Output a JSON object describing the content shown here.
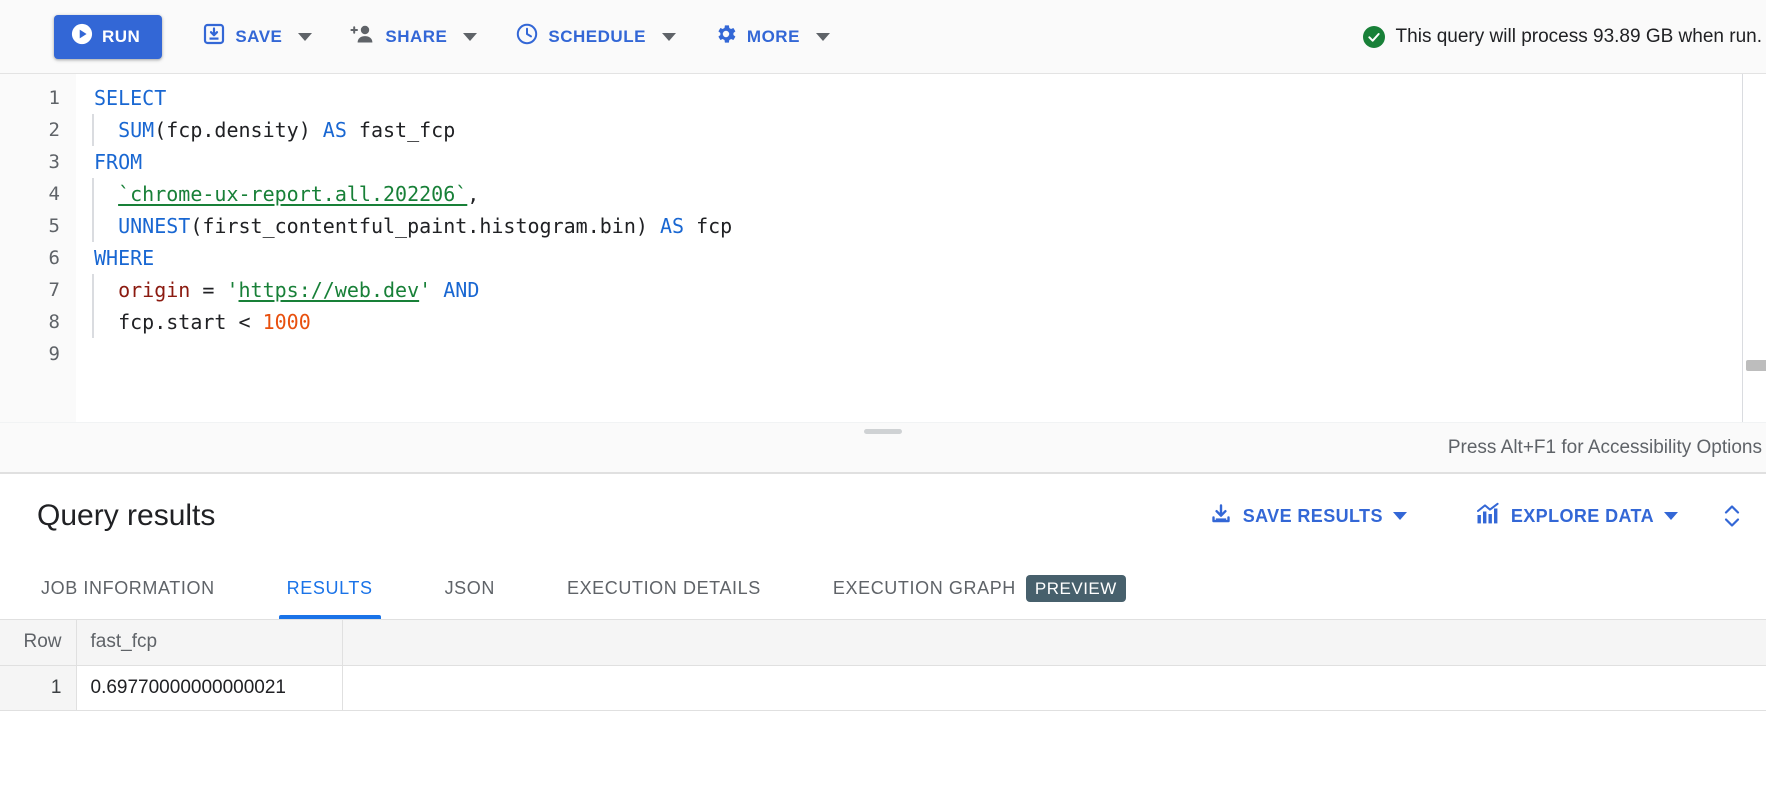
{
  "toolbar": {
    "run_label": "RUN",
    "save_label": "SAVE",
    "share_label": "SHARE",
    "schedule_label": "SCHEDULE",
    "more_label": "MORE",
    "status_text": "This query will process 93.89 GB when run."
  },
  "editor": {
    "line_numbers": [
      "1",
      "2",
      "3",
      "4",
      "5",
      "6",
      "7",
      "8",
      "9"
    ],
    "lines": [
      {
        "n": "1",
        "tokens": [
          {
            "t": "SELECT",
            "c": "kw"
          }
        ]
      },
      {
        "n": "2",
        "tokens": [
          {
            "t": "  ",
            "c": "plain"
          },
          {
            "t": "SUM",
            "c": "fn"
          },
          {
            "t": "(fcp.density) ",
            "c": "plain"
          },
          {
            "t": "AS",
            "c": "kw"
          },
          {
            "t": " fast_fcp",
            "c": "plain"
          }
        ]
      },
      {
        "n": "3",
        "tokens": [
          {
            "t": "FROM",
            "c": "kw"
          }
        ]
      },
      {
        "n": "4",
        "tokens": [
          {
            "t": "  ",
            "c": "plain"
          },
          {
            "t": "`chrome-ux-report.all.202206`",
            "c": "link"
          },
          {
            "t": ",",
            "c": "plain"
          }
        ]
      },
      {
        "n": "5",
        "tokens": [
          {
            "t": "  ",
            "c": "plain"
          },
          {
            "t": "UNNEST",
            "c": "fn"
          },
          {
            "t": "(first_contentful_paint.histogram.bin) ",
            "c": "plain"
          },
          {
            "t": "AS",
            "c": "kw"
          },
          {
            "t": " fcp",
            "c": "plain"
          }
        ]
      },
      {
        "n": "6",
        "tokens": [
          {
            "t": "WHERE",
            "c": "kw"
          }
        ]
      },
      {
        "n": "7",
        "tokens": [
          {
            "t": "  ",
            "c": "plain"
          },
          {
            "t": "origin",
            "c": "field"
          },
          {
            "t": " = ",
            "c": "plain"
          },
          {
            "t": "'",
            "c": "str"
          },
          {
            "t": "https://web.dev",
            "c": "link"
          },
          {
            "t": "'",
            "c": "str"
          },
          {
            "t": " ",
            "c": "plain"
          },
          {
            "t": "AND",
            "c": "kw"
          }
        ]
      },
      {
        "n": "8",
        "tokens": [
          {
            "t": "  ",
            "c": "plain"
          },
          {
            "t": "fcp.start < ",
            "c": "plain"
          },
          {
            "t": "1000",
            "c": "num"
          }
        ]
      },
      {
        "n": "9",
        "tokens": []
      }
    ],
    "accessibility_hint": "Press Alt+F1 for Accessibility Options"
  },
  "results": {
    "title": "Query results",
    "save_results_label": "SAVE RESULTS",
    "explore_data_label": "EXPLORE DATA",
    "tabs": [
      {
        "label": "JOB INFORMATION",
        "active": false,
        "badge": null
      },
      {
        "label": "RESULTS",
        "active": true,
        "badge": null
      },
      {
        "label": "JSON",
        "active": false,
        "badge": null
      },
      {
        "label": "EXECUTION DETAILS",
        "active": false,
        "badge": null
      },
      {
        "label": "EXECUTION GRAPH",
        "active": false,
        "badge": "PREVIEW"
      }
    ],
    "table": {
      "columns": [
        "Row",
        "fast_fcp"
      ],
      "rows": [
        {
          "row": "1",
          "fast_fcp": "0.69770000000000021"
        }
      ]
    }
  },
  "colors": {
    "accent_blue": "#3367d6",
    "tab_blue": "#1a73e8",
    "success_green": "#188038",
    "preview_badge": "#47606c",
    "keyword_blue": "#1967d2",
    "string_green": "#188038",
    "number_orange": "#e8500e",
    "field_maroon": "#8b1a10"
  }
}
